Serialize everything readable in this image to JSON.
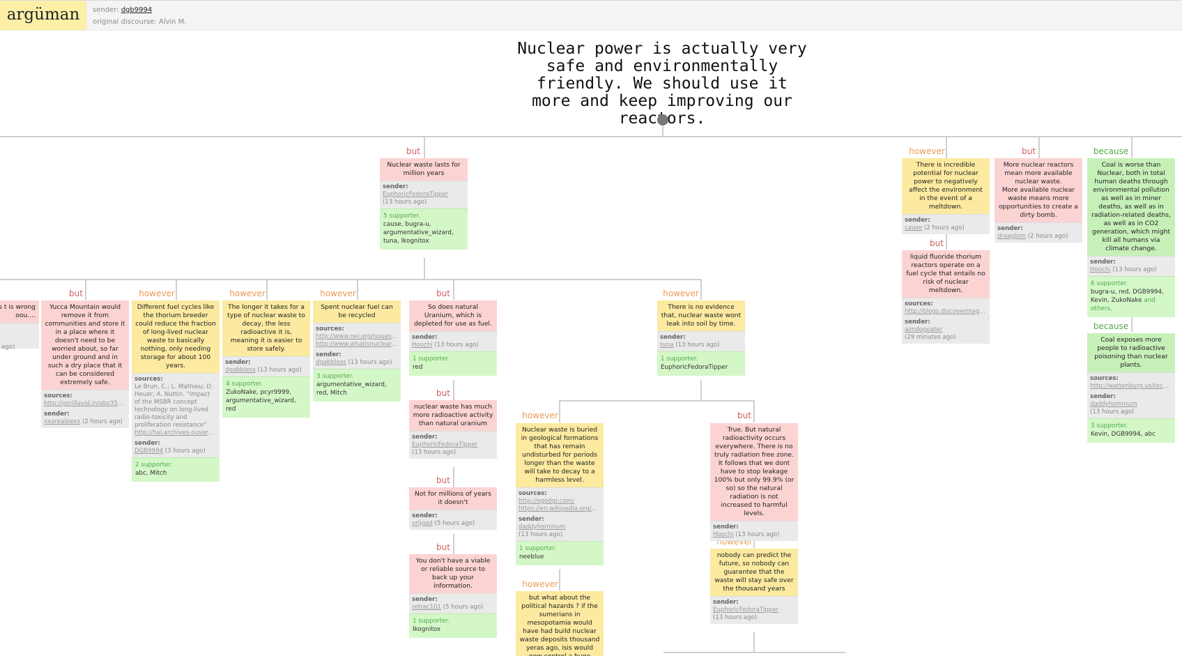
{
  "app": {
    "logo": "argüman",
    "sender_label": "sender:",
    "sender_name": "dgb9994",
    "original_label": "original discourse: Alvin M."
  },
  "title": "Nuclear power is actually very safe and environmentally friendly. We should use it more and keep improving our reactors.",
  "labels": {
    "but": "but",
    "however": "however",
    "because": "because",
    "sender": "sender:",
    "sources": "sources:"
  },
  "cards": {
    "c1": {
      "text": "Nuclear waste lasts for million years",
      "sender": "EuphoricFedoraTipper",
      "time": "(13 hours ago)",
      "sup_count": "5 supporter.",
      "supporters": "cause, bugra-u, argumentative_wizard, tuna, Ikognitox"
    },
    "c2": {
      "text": "There is incredible potential for nuclear power to negatively affect the environment in the event of a meltdown.",
      "sender": "cause",
      "time": "(2 hours ago)"
    },
    "c3": {
      "text": "More nuclear reactors mean more available nuclear waste.\nMore available nuclear waste means more opportunities to create a dirty bomb.",
      "sender": "draaglom",
      "time": "(2 hours ago)"
    },
    "c4": {
      "text": "Coal is worse than Nuclear, both in total human deaths through environmental pollution as well as in miner deaths, as well as in radiation-related deaths, as well as in CO2 generation, which might kill all humans via climate change.",
      "sender": "Hoochi",
      "time": "(13 hours ago)",
      "sup_count": "6 supporter.",
      "supporters": "bugra-u, red, DGB9994, Kevin, ZukoNake",
      "others": "and others."
    },
    "c5": {
      "text": "liquid fluoride thorium reactors operate on a fuel cycle that entails no risk of nuclear meltdown.",
      "source": "http://blogs.discovermagazine.com",
      "sender": "azndogeater",
      "time": "(29 minutes ago)"
    },
    "c6": {
      "text": "Coal exposes more people to radioactive poisoning than nuclear plants.",
      "source": "http://wattenburg.us/techreview",
      "sender": "daddyhominum",
      "time": "(13 hours ago)",
      "sup_count": "3 supporter.",
      "supporters": "Kevin, DGB9994, abc"
    },
    "c7": {
      "text": "g Jeeesus t is wrong oou....",
      "time": "ago)"
    },
    "c8": {
      "text": "Yucca Mountain would remove it from communities and store it in a place where it doesn't need to be worried about, so far under ground and in such a dry place that it can be considered extremely safe.",
      "source": "http://gorillavid.in/abz35s4h",
      "sender": "xxarealeexx",
      "time": "(2 hours ago)"
    },
    "c9": {
      "text": "Different fuel cycles like the thorium breeder could reduce the fraction of long-lived nuclear waste to basically nothing, only needing storage for about 100 years.",
      "sources_text": "Le Brun, C.; L. Mathieu; D. Heuer; A. Nuttin. \"Impact of the MSBR concept technology on long-lived radio-toxicity and proliferation resistance\"",
      "source": "http://hal.archives-ouvertes.fr",
      "sender": "DGB9994",
      "time": "(3 hours ago)",
      "sup_count": "2 supporter.",
      "supporters": "abc, Mitch"
    },
    "c10": {
      "text": "The longer it takes for a type of nuclear waste to decay, the less radioactive it is, meaning it is easier to store safely.",
      "sender": "dgabbless",
      "time": "(13 hours ago)",
      "sup_count": "4 supporter.",
      "supporters": "ZukoNake, pcyr9999, argumentative_wizard, red"
    },
    "c11": {
      "text": "Spent nuclear fuel can be recycled",
      "source1": "http://www.nei.org/Issues-Policy",
      "source2": "http://www.whatisnuclear.com",
      "sender": "dgabbless",
      "time": "(13 hours ago)",
      "sup_count": "3 supporter.",
      "supporters": "argumentative_wizard, red, Mitch"
    },
    "c12": {
      "text": "So does natural Uranium, which is depleted for use as fuel.",
      "sender": "Hoochi",
      "time": "(13 hours ago)",
      "sup_count": "1 supporter.",
      "supporters": "red"
    },
    "c13": {
      "text": "nuclear waste has much more radioactive activity than natural uranium",
      "sender": "EuphoricFedoraTipper",
      "time": "(13 hours ago)"
    },
    "c14": {
      "text": "Not for millions of years it doesn't",
      "sender": "orijgad",
      "time": "(5 hours ago)"
    },
    "c15": {
      "text": "You don't have a viable or reliable source to back up your information.",
      "sender": "retrac101",
      "time": "(5 hours ago)",
      "sup_count": "1 supporter.",
      "supporters": "Ikognitox"
    },
    "c16": {
      "text": "There is no evidence that, nuclear waste wont leak into soil by time.",
      "sender": "tuna",
      "time": "(13 hours ago)",
      "sup_count": "1 supporter.",
      "supporters": "EuphoricFedoraTipper"
    },
    "c17": {
      "text": "Nuclear waste is buried in geological formations that has remain undisturbed for periods longer than the waste will take to decay to a harmless level.",
      "source1": "http://ogodgr.com/",
      "source2": "https://en.wikipedia.org/wiki",
      "sender": "daddyhominum",
      "time": "(13 hours ago)",
      "sup_count": "1 supporter.",
      "supporters": "neeblue"
    },
    "c18": {
      "text": "True. But natural radioactivity occurs everywhere. There is no truly radiation free zone. It follows that we dont have to stop leakage 100% but only 99.9% (or so) so the natural radiation is not increased to harmful levels.",
      "sender": "Hoochi",
      "time": "(13 hours ago)"
    },
    "c19": {
      "text": "nobody can predict the future, so nobody can guarantee that the waste will stay safe over the thousand years",
      "sender": "EuphoricFedoraTipper",
      "time": "(13 hours ago)"
    },
    "c20": {
      "text": "but what about the political hazards ? if the sumerians in mesopotamia would have had build nuclear waste deposits thousand yeras ago, isis would now control a huge amount of hazardous nuclear waste"
    }
  }
}
